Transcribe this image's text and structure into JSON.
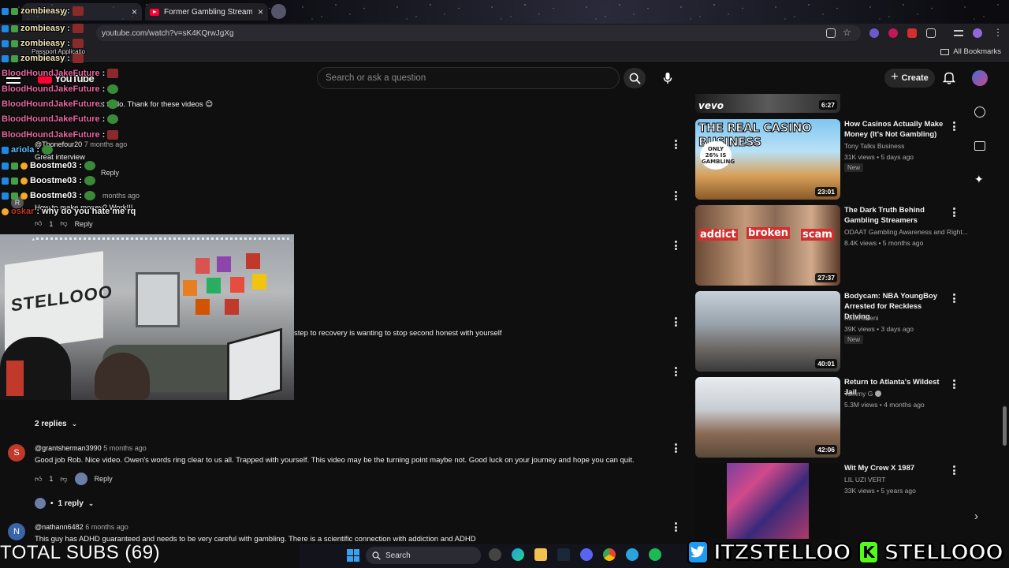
{
  "browser": {
    "tabs": [
      {
        "label": "zombieasy"
      },
      {
        "label": "Former Gambling Streamer EX..."
      }
    ],
    "url": "youtube.com/watch?v=sK4KQrwJgXg",
    "bookmarks_label": "All Bookmarks"
  },
  "youtube": {
    "logo": "YouTube",
    "search_placeholder": "Search or ask a question",
    "create_label": "Create"
  },
  "chat": {
    "lines": [
      {
        "name": "zombieasy",
        "text": ":"
      },
      {
        "name": "zombieasy",
        "text": ":"
      },
      {
        "name": "zombieasy",
        "text": ":"
      },
      {
        "name": "Passport Applicatio",
        "text": ""
      },
      {
        "name": "zombieasy",
        "text": ":"
      },
      {
        "name": "BloodHoundJakeFuture",
        "text": ":"
      },
      {
        "name": "BloodHoundJakeFuture",
        "text": ":"
      },
      {
        "name": "BloodHoundJakeFuture",
        "text": ":"
      },
      {
        "name": "BloodHoundJakeFuture",
        "text": ":"
      },
      {
        "name": "BloodHoundJakeFuture",
        "text": ":"
      },
      {
        "name": "ariola",
        "text": ":"
      },
      {
        "name": "Boostme03",
        "text": ":"
      },
      {
        "name": "Boostme03",
        "text": ":"
      },
      {
        "name": "Boostme03",
        "text": ":"
      },
      {
        "name": "oskar",
        "text": ": why do you hate me rq"
      }
    ]
  },
  "comments": {
    "c0": {
      "text": "nts to do. Thank for these videos 😊"
    },
    "c1": {
      "author": "@Tbonefour20",
      "time": "7 months ago",
      "text": "Great interview",
      "reply": "Reply"
    },
    "c2": {
      "time": "months ago",
      "text": "How to make money? Work!!!",
      "likes": "1",
      "reply": "Reply"
    },
    "c3_tail": "step to recovery is wanting to stop second honest with yourself",
    "replies_2": "2 replies",
    "c4": {
      "avatar": "S",
      "author": "@grantsherman3990",
      "time": "5 months ago",
      "text": "Good job Rob. Nice video. Owen's words ring clear to us all. Trapped with yourself. This video may be the turning point maybe not. Good luck on your journey and hope you can quit.",
      "likes": "1",
      "reply": "Reply"
    },
    "replies_1": "1 reply",
    "c5": {
      "avatar": "N",
      "author": "@nathann6482",
      "time": "6 months ago",
      "text": "This guy has ADHD guaranteed and needs to be very careful with gambling. There is a scientific connection with addiction and ADHD"
    }
  },
  "webcam": {
    "banner_text": "STELLOOO"
  },
  "sidebar": {
    "top_partial": {
      "logo": "vevo",
      "duration": "6:27"
    },
    "videos": [
      {
        "title": "How Casinos Actually Make Money (It's Not Gambling)",
        "channel": "Tony Talks Business",
        "stats": "31K views • 5 days ago",
        "badge": "New",
        "duration": "23:01",
        "thumb_text": "THE REAL CASINO BUSINESS",
        "thumb_sub": "ONLY 26% IS GAMBLING"
      },
      {
        "title": "The Dark Truth Behind Gambling Streamers",
        "channel": "ODAAT Gambling Awareness and Right...",
        "stats": "8.4K views • 5 months ago",
        "duration": "27:37",
        "tags": [
          "addict",
          "broken",
          "scam"
        ]
      },
      {
        "title": "Bodycam: NBA YoungBoy Arrested for Reckless Driving",
        "channel": "Kalavisheni",
        "stats": "39K views • 3 days ago",
        "badge": "New",
        "duration": "40:01"
      },
      {
        "title": "Return to Atlanta's Wildest Jail",
        "channel": "Tommy G",
        "stats": "5.3M views • 4 months ago",
        "duration": "42:06"
      },
      {
        "title": "Wit My Crew X 1987",
        "channel": "LIL UZI VERT",
        "stats": "33K views • 5 years ago",
        "duration": ""
      }
    ]
  },
  "stream": {
    "total_subs": "TOTAL SUBS (69)",
    "twitter": "ITZSTELLOO",
    "kick": "STELLOOO"
  },
  "taskbar": {
    "search_label": "Search"
  }
}
